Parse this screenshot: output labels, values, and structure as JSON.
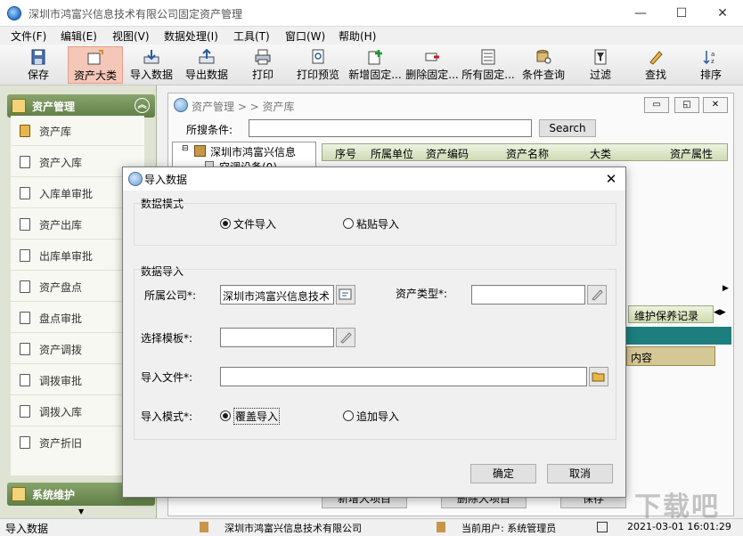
{
  "window": {
    "title": "深圳市鸿富兴信息技术有限公司固定资产管理",
    "min": "—",
    "max": "☐",
    "close": "✕"
  },
  "menu": [
    "文件(F)",
    "编辑(E)",
    "视图(V)",
    "数据处理(I)",
    "工具(T)",
    "窗口(W)",
    "帮助(H)"
  ],
  "toolbar": [
    "保存",
    "资产大类",
    "导入数据",
    "导出数据",
    "打印",
    "打印预览",
    "新增固定...",
    "删除固定...",
    "所有固定...",
    "条件查询",
    "过滤",
    "查找",
    "排序"
  ],
  "sidebar": {
    "header": "资产管理",
    "items": [
      "资产库",
      "资产入库",
      "入库单审批",
      "资产出库",
      "出库单审批",
      "资产盘点",
      "盘点审批",
      "资产调拨",
      "调拨审批",
      "调拨入库",
      "资产折旧"
    ],
    "footer": "系统维护"
  },
  "panel": {
    "breadcrumb": "资产管理 > > 资产库",
    "search_label": "所搜条件:",
    "search_value": "",
    "search_button": "Search",
    "tree_root": "深圳市鸿富兴信息",
    "tree_child": "空调设备(0)",
    "columns": [
      "序号",
      "所属单位",
      "资产编码",
      "资产名称",
      "大类",
      "资产属性"
    ],
    "tab_label": "维护保养记录",
    "content_label": "内容",
    "bottom_btn1": "新增大项目",
    "bottom_btn2": "删除大项目",
    "bottom_btn3": "保存"
  },
  "statusbar": {
    "left": "导入数据",
    "company": "深圳市鸿富兴信息技术有限公司",
    "user": "当前用户: 系统管理员",
    "datetime": "2021-03-01 16:01:29"
  },
  "dialog": {
    "title": "导入数据",
    "mode_group": "数据模式",
    "mode_file": "文件导入",
    "mode_paste": "粘贴导入",
    "import_group": "数据导入",
    "company_label": "所属公司*:",
    "company_value": "深圳市鸿富兴信息技术",
    "type_label": "资产类型*:",
    "type_value": "",
    "template_label": "选择模板*:",
    "template_value": "",
    "file_label": "导入文件*:",
    "file_value": "",
    "importmode_label": "导入模式*:",
    "importmode_overwrite": "覆盖导入",
    "importmode_append": "追加导入",
    "ok": "确定",
    "cancel": "取消"
  },
  "watermark": "下载吧"
}
